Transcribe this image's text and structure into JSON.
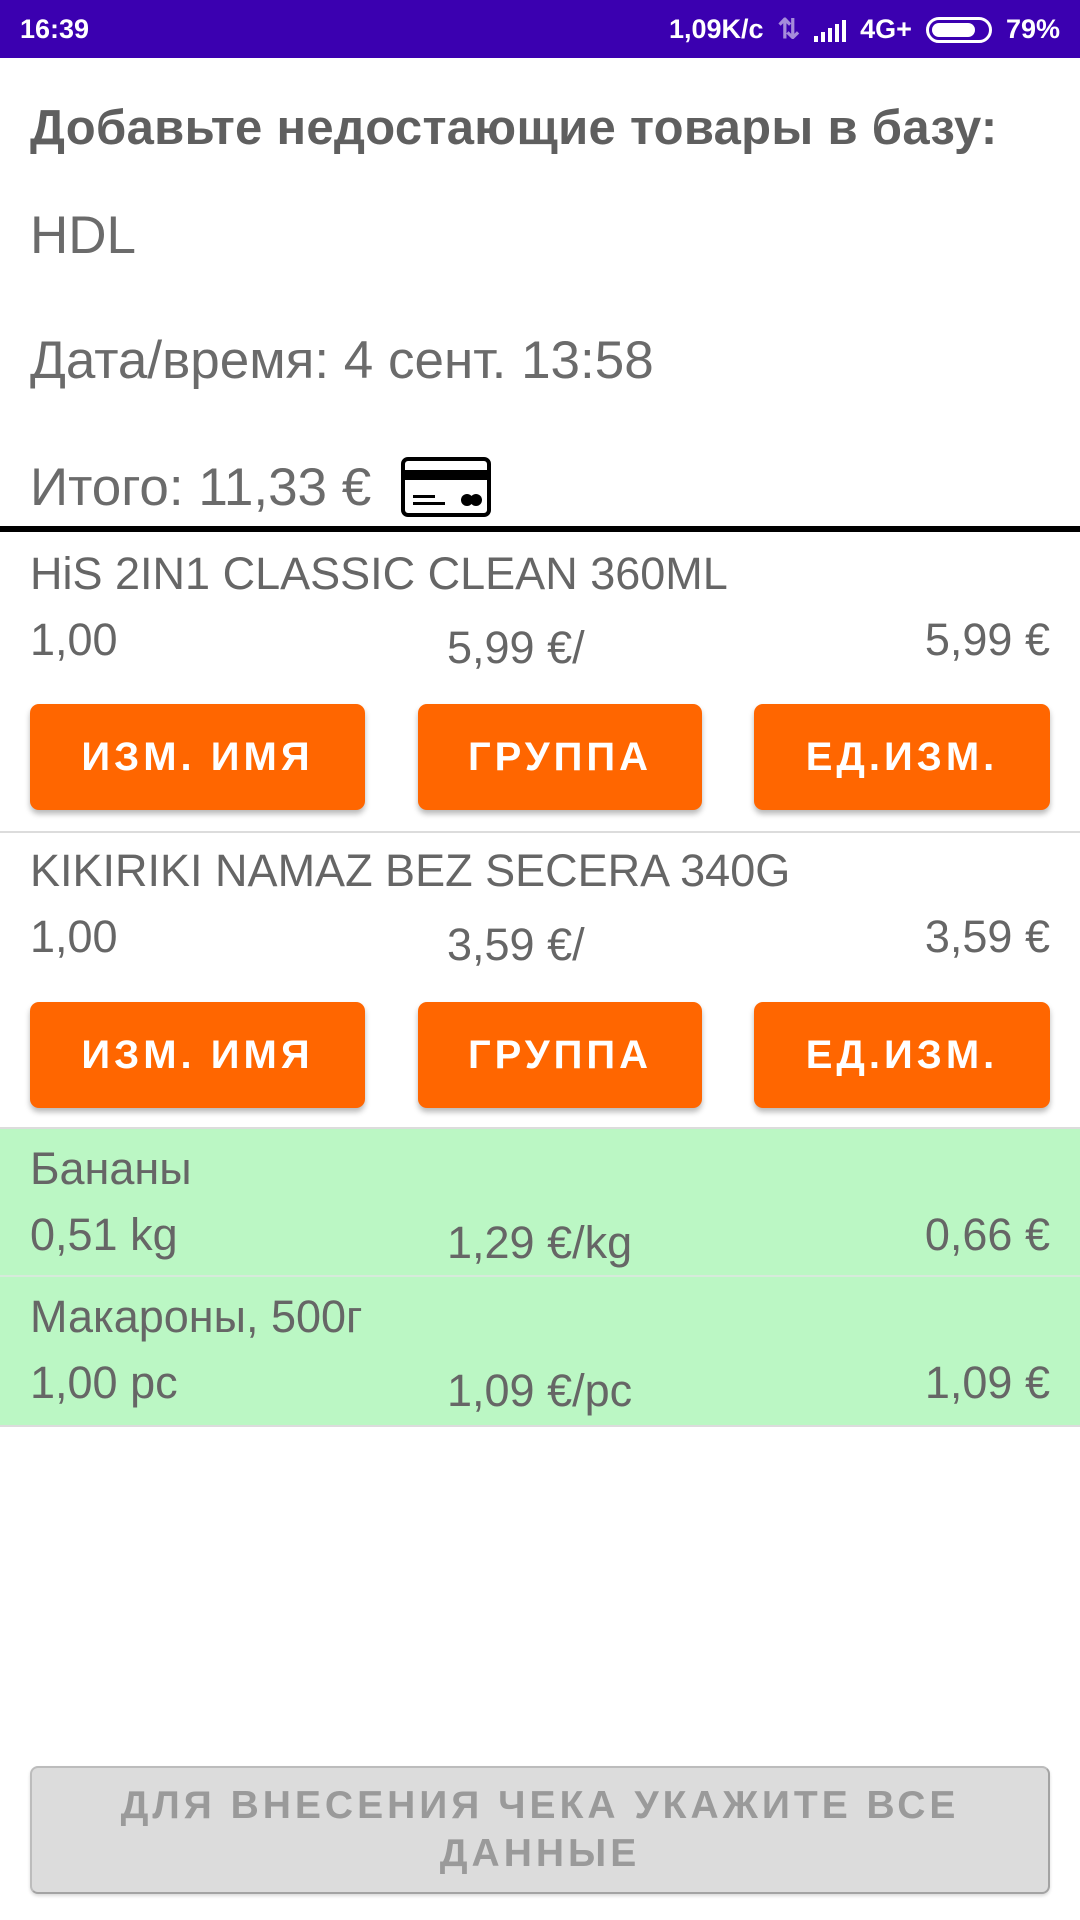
{
  "status_bar": {
    "time": "16:39",
    "speed": "1,09K/c",
    "network": "4G+",
    "battery": "79%",
    "battery_level": 0.79,
    "icons": [
      "data-transfer-icon",
      "signal-icon",
      "battery-icon"
    ]
  },
  "header": {
    "title": "Добавьте недостающие товары в базу:",
    "store": "HDL",
    "datetime": "Дата/время: 4 сент. 13:58",
    "total": "Итого: 11,33 €",
    "payment_icon": "credit-card-icon"
  },
  "items": [
    {
      "name": "HiS 2IN1 CLASSIC CLEAN 360ML",
      "qty": "1,00",
      "unit_price": "5,99 €/",
      "sum": "5,99 €",
      "buttons": {
        "rename": "ИЗМ. ИМЯ",
        "group": "ГРУППА",
        "unit": "ЕД.ИЗМ."
      }
    },
    {
      "name": "KIKIRIKI NAMAZ BEZ SECERA 340G",
      "qty": "1,00",
      "unit_price": "3,59 €/",
      "sum": "3,59 €",
      "buttons": {
        "rename": "ИЗМ. ИМЯ",
        "group": "ГРУППА",
        "unit": "ЕД.ИЗМ."
      }
    },
    {
      "name": "Бананы",
      "qty": "0,51 kg",
      "unit_price": "1,29 €/kg",
      "sum": "0,66 €"
    },
    {
      "name": "Макароны, 500г",
      "qty": "1,00 pc",
      "unit_price": "1,09 €/pc",
      "sum": "1,09 €"
    }
  ],
  "footer": {
    "submit_label": "ДЛЯ ВНЕСЕНИЯ ЧЕКА УКАЖИТЕ ВСЕ ДАННЫЕ"
  },
  "colors": {
    "status_bar": "#3b00b0",
    "accent_button": "#ff6600",
    "matched_row": "#bbf7c4",
    "disabled_button": "#dcdcdc"
  }
}
